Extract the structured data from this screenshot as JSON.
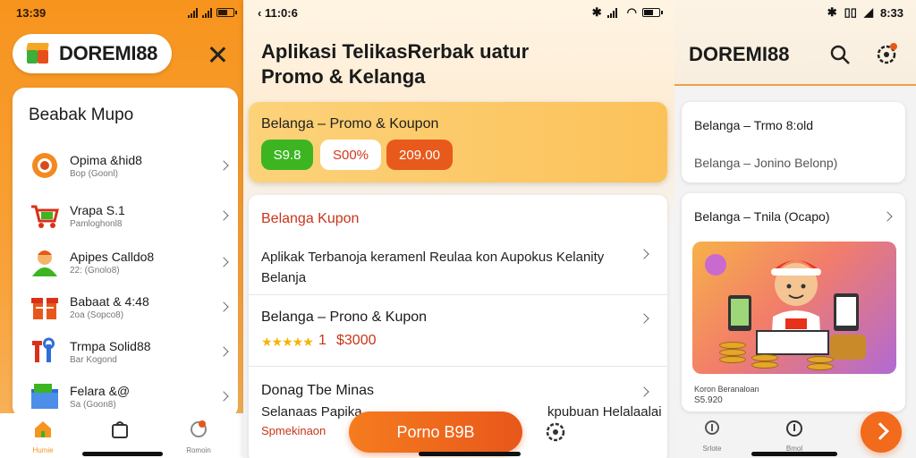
{
  "panel_left": {
    "status": {
      "time": "13:39"
    },
    "brand": {
      "name": "DOREMI88"
    },
    "menu": {
      "title": "Beabak Mupo",
      "items": [
        {
          "title": "Opima &hid8",
          "sub": "Bop (Goonl)"
        },
        {
          "title": "Vrapa S.1",
          "sub": "Pamloghonl8"
        },
        {
          "title": "Apipes Calldo8",
          "sub": "22: (Gnolo8)"
        },
        {
          "title": "Babaat & 4:48",
          "sub": "2oa (Sopco8)"
        },
        {
          "title": "Trmpa Solid88",
          "sub": "Bar Kogond"
        },
        {
          "title": "Felara &@",
          "sub": "Sa (Goon8)"
        }
      ]
    },
    "tabs": [
      {
        "label": "Humie"
      },
      {
        "label": ""
      },
      {
        "label": "Romoin"
      }
    ],
    "colors": {
      "accent": "#f7941d"
    }
  },
  "panel_middle": {
    "status": {
      "time": "11:0:6"
    },
    "header": {
      "line1": "Aplikasi TelikasRerbak uatur",
      "line2": "Promo & Kelanga"
    },
    "promo": {
      "title": "Belanga – Promo & Koupon",
      "chips": [
        {
          "label": "S9.8",
          "bg": "#3cb521",
          "fg": "#ffffff"
        },
        {
          "label": "S00%",
          "bg": "#ffffff",
          "fg": "#d0381c"
        },
        {
          "label": "209.00",
          "bg": "#e85a1c",
          "fg": "#ffffff"
        }
      ]
    },
    "kupon": {
      "title": "Belanga Kupon",
      "desc": "Aplikak Terbanoja keramenl Reulaa kon Aupokus Kelanity Belanja"
    },
    "product": {
      "title": "Belanga – Prono & Kupon",
      "stars": "★★★★★",
      "rating": "1",
      "price": "$3000"
    },
    "section3": {
      "title": "Donag Tbe Minas",
      "line": "Selanaas Papika",
      "line_end": "kpubuan Helalaalai",
      "orange": "Spmekinaon"
    },
    "fab": {
      "label": "Porno B9B"
    }
  },
  "panel_right": {
    "status": {
      "time": "8:33"
    },
    "brand": {
      "name": "DOREMI88"
    },
    "card1": {
      "line1": "Belanga – Trmo 8:old",
      "line2": "Belanga – Jonino Belonp)"
    },
    "card2": {
      "line1": "Belanga – Tnila (Ocapo)",
      "caption": "Koron Beranaloan",
      "caption2": "S5.920"
    },
    "tabs": [
      {
        "label": "Srlote"
      },
      {
        "label": "Bmol"
      }
    ]
  }
}
